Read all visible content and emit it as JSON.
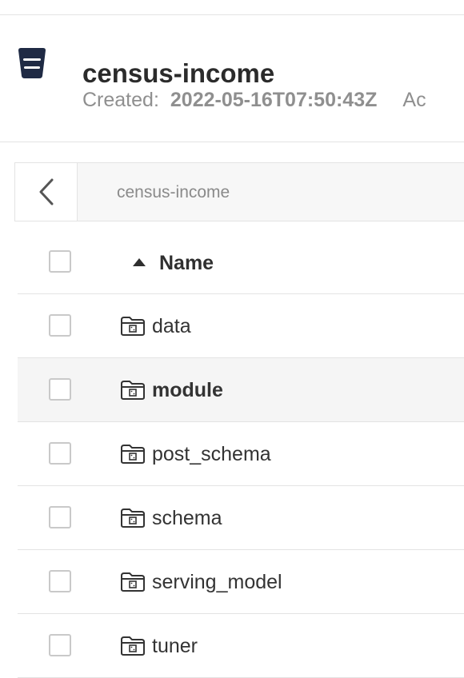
{
  "bucket": {
    "name": "census-income",
    "created_label": "Created:",
    "created_value": "2022-05-16T07:50:43Z",
    "extra_label": "Ac"
  },
  "breadcrumb": {
    "path": "census-income"
  },
  "table": {
    "name_header": "Name",
    "items": [
      {
        "name": "data"
      },
      {
        "name": "module"
      },
      {
        "name": "post_schema"
      },
      {
        "name": "schema"
      },
      {
        "name": "serving_model"
      },
      {
        "name": "tuner"
      }
    ]
  },
  "colors": {
    "bucket_icon": "#1f2a44",
    "border": "#e3e3e3",
    "highlight_row": "#f5f5f5",
    "muted_text": "#8f8f8f"
  }
}
